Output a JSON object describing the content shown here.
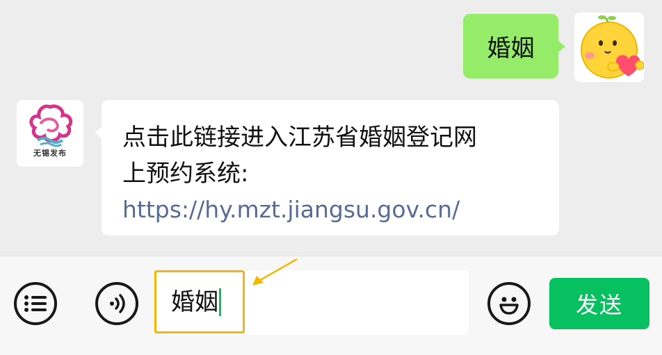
{
  "chat": {
    "outgoing": {
      "text": "婚姻",
      "avatar_icon": "yellow-emoji-heart-avatar"
    },
    "incoming": {
      "avatar_icon": "wuxi-release-logo",
      "avatar_brand": "无锡发布",
      "line1": "点击此链接进入江苏省婚姻登记网",
      "line2": "上预约系统:",
      "link": "https://hy.mzt.jiangsu.gov.cn/"
    }
  },
  "input_bar": {
    "menu_icon": "list-menu-icon",
    "voice_icon": "voice-icon",
    "input_value": "婚姻",
    "emoji_icon": "smiley-icon",
    "send_label": "发送"
  },
  "colors": {
    "background": "#ededed",
    "outgoing_bubble": "#95ec69",
    "link": "#576b95",
    "send_button": "#07c160",
    "highlight": "#f7b500"
  }
}
